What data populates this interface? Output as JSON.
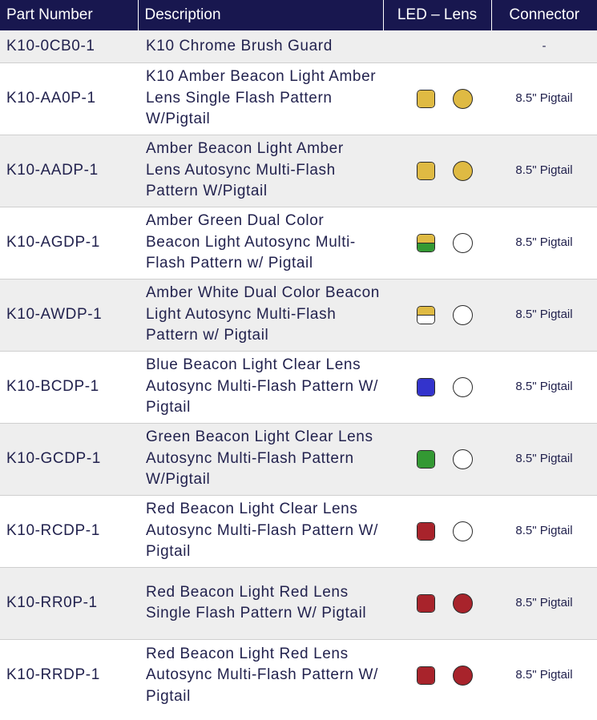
{
  "table": {
    "headers": [
      "Part Number",
      "Description",
      "LED – Lens",
      "Connector"
    ],
    "rows": [
      {
        "part": "K10-0CB0-1",
        "description": "K10 Chrome Brush Guard",
        "led": [],
        "lens": null,
        "connector": "-"
      },
      {
        "part": "K10-AA0P-1",
        "description": "K10 Amber Beacon Light Amber Lens Single Flash Pattern W/Pigtail",
        "led": [
          "#dfba43"
        ],
        "lens": "#dfba43",
        "connector": "8.5\" Pigtail"
      },
      {
        "part": "K10-AADP-1",
        "description": "Amber Beacon Light Amber Lens Autosync Multi-Flash Pattern W/Pigtail",
        "led": [
          "#dfba43"
        ],
        "lens": "#dfba43",
        "connector": "8.5\" Pigtail"
      },
      {
        "part": "K10-AGDP-1",
        "description": "Amber Green Dual Color Beacon Light Autosync Multi-Flash Pattern w/ Pigtail",
        "led": [
          "#dfba43",
          "#339933"
        ],
        "lens": "#ffffff",
        "connector": "8.5\" Pigtail"
      },
      {
        "part": "K10-AWDP-1",
        "description": "Amber White Dual Color Beacon Light Autosync Multi-Flash Pattern w/ Pigtail",
        "led": [
          "#dfba43",
          "#ffffff"
        ],
        "lens": "#ffffff",
        "connector": "8.5\" Pigtail"
      },
      {
        "part": "K10-BCDP-1",
        "description": "Blue Beacon Light Clear Lens Autosync Multi-Flash Pattern W/ Pigtail",
        "led": [
          "#3333cc"
        ],
        "lens": "#ffffff",
        "connector": "8.5\" Pigtail"
      },
      {
        "part": "K10-GCDP-1",
        "description": "Green Beacon Light Clear Lens Autosync Multi-Flash Pattern W/Pigtail",
        "led": [
          "#339933"
        ],
        "lens": "#ffffff",
        "connector": "8.5\" Pigtail"
      },
      {
        "part": "K10-RCDP-1",
        "description": "Red Beacon Light Clear Lens Autosync Multi-Flash Pattern W/ Pigtail",
        "led": [
          "#a8232b"
        ],
        "lens": "#ffffff",
        "connector": "8.5\" Pigtail"
      },
      {
        "part": "K10-RR0P-1",
        "description": "Red Beacon Light Red Lens Single Flash Pattern W/ Pigtail",
        "led": [
          "#a8232b"
        ],
        "lens": "#a8232b",
        "connector": "8.5\" Pigtail"
      },
      {
        "part": "K10-RRDP-1",
        "description": "Red Beacon Light Red Lens Autosync Multi-Flash Pattern W/ Pigtail",
        "led": [
          "#a8232b"
        ],
        "lens": "#a8232b",
        "connector": "8.5\" Pigtail"
      }
    ]
  }
}
